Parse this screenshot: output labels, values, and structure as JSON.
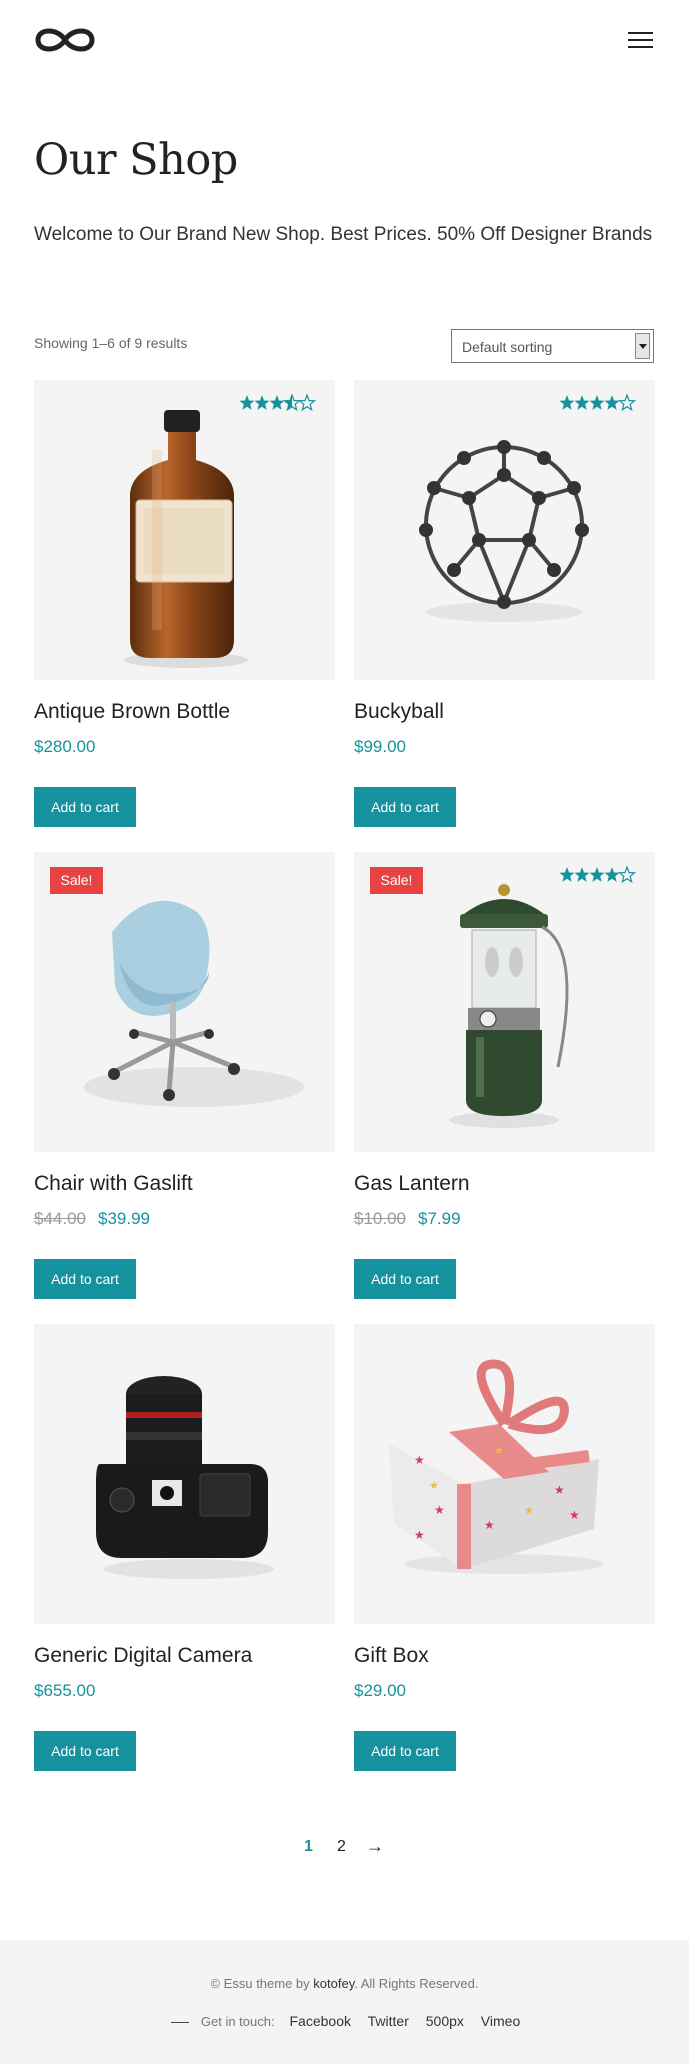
{
  "header": {
    "logo": "infinity-logo",
    "menu_icon": "hamburger-menu-icon"
  },
  "page": {
    "title": "Our Shop",
    "intro": "Welcome to Our Brand New Shop. Best Prices. 50% Off Designer Brands"
  },
  "toolbar": {
    "result_count": "Showing 1–6 of 9 results",
    "sort_selected": "Default sorting"
  },
  "products": [
    {
      "name": "Antique Brown Bottle",
      "price": "$280.00",
      "old_price": "",
      "sale_badge": "",
      "rating": 3.5,
      "rating_max": 5,
      "button": "Add to cart",
      "image": "brown-bottle-image"
    },
    {
      "name": "Buckyball",
      "price": "$99.00",
      "old_price": "",
      "sale_badge": "",
      "rating": 4,
      "rating_max": 5,
      "button": "Add to cart",
      "image": "buckyball-image"
    },
    {
      "name": "Chair with Gaslift",
      "price": "$39.99",
      "old_price": "$44.00",
      "sale_badge": "Sale!",
      "rating": 0,
      "rating_max": 5,
      "button": "Add to cart",
      "image": "chair-image"
    },
    {
      "name": "Gas Lantern",
      "price": "$7.99",
      "old_price": "$10.00",
      "sale_badge": "Sale!",
      "rating": 4,
      "rating_max": 5,
      "button": "Add to cart",
      "image": "lantern-image"
    },
    {
      "name": "Generic Digital Camera",
      "price": "$655.00",
      "old_price": "",
      "sale_badge": "",
      "rating": 0,
      "rating_max": 5,
      "button": "Add to cart",
      "image": "camera-image"
    },
    {
      "name": "Gift Box",
      "price": "$29.00",
      "old_price": "",
      "sale_badge": "",
      "rating": 0,
      "rating_max": 5,
      "button": "Add to cart",
      "image": "gift-box-image"
    }
  ],
  "pagination": {
    "current": "1",
    "next_page": "2",
    "next_arrow": "→"
  },
  "footer": {
    "copyright_prefix": "© Essu theme by ",
    "author": "kotofey",
    "copyright_suffix": ". All Rights Reserved.",
    "get_in_touch": "Get in touch:",
    "links": [
      "Facebook",
      "Twitter",
      "500px",
      "Vimeo"
    ]
  },
  "colors": {
    "accent": "#16929f",
    "sale": "#e84343",
    "footer_bg": "#f4f4f4",
    "card_bg": "#f5f4f4"
  }
}
